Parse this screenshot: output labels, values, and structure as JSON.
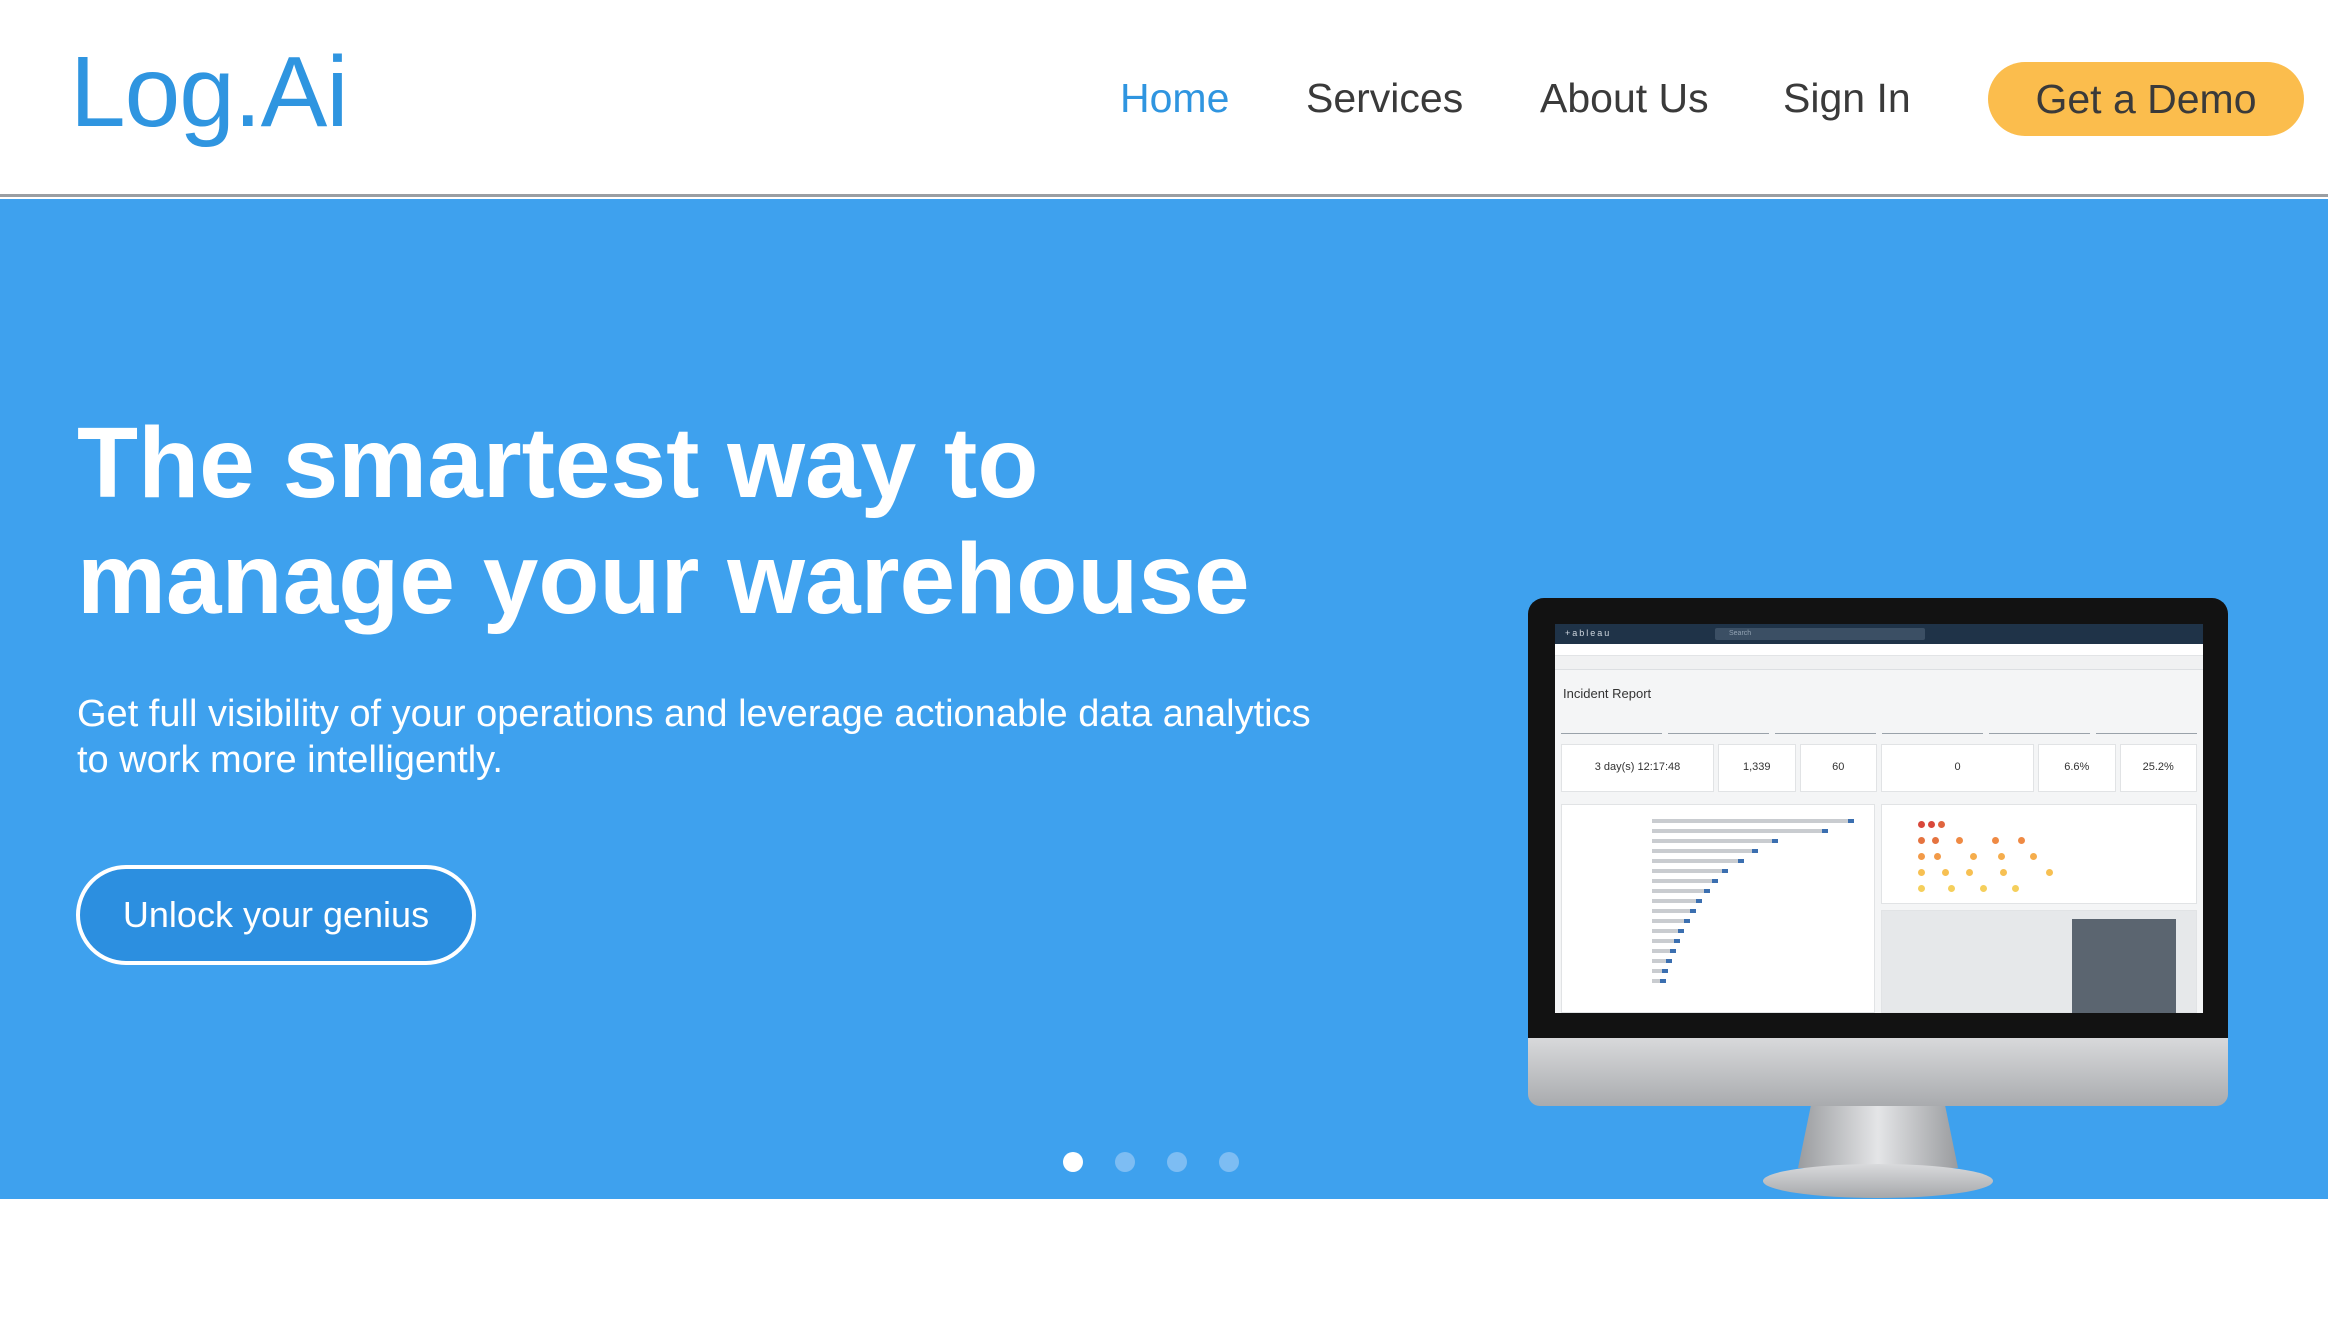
{
  "header": {
    "logo": "Log.Ai",
    "nav": [
      {
        "label": "Home",
        "active": true
      },
      {
        "label": "Services",
        "active": false
      },
      {
        "label": "About Us",
        "active": false
      },
      {
        "label": "Sign In",
        "active": false
      }
    ],
    "demo_button": "Get a Demo"
  },
  "hero": {
    "headline": "The smartest way to\nmanage your warehouse",
    "subtext": "Get full visibility of your operations and leverage actionable data analytics to work more intelligently.",
    "cta": "Unlock your genius",
    "carousel": {
      "slides": 4,
      "active": 0
    }
  },
  "screen": {
    "brand": "+ableau",
    "search_placeholder": "Search",
    "title": "Incident Report",
    "kpis": [
      "3 day(s) 12:17:48",
      "1,339",
      "60",
      "0",
      "6.6%",
      "25.2%"
    ]
  },
  "colors": {
    "brand": "#2f95e0",
    "hero_bg": "#3ea1ee",
    "demo_button": "#fbbd4d",
    "cta_bg": "#2c8fe0"
  },
  "icons": {
    "screen": "monitor-dashboard-image"
  }
}
